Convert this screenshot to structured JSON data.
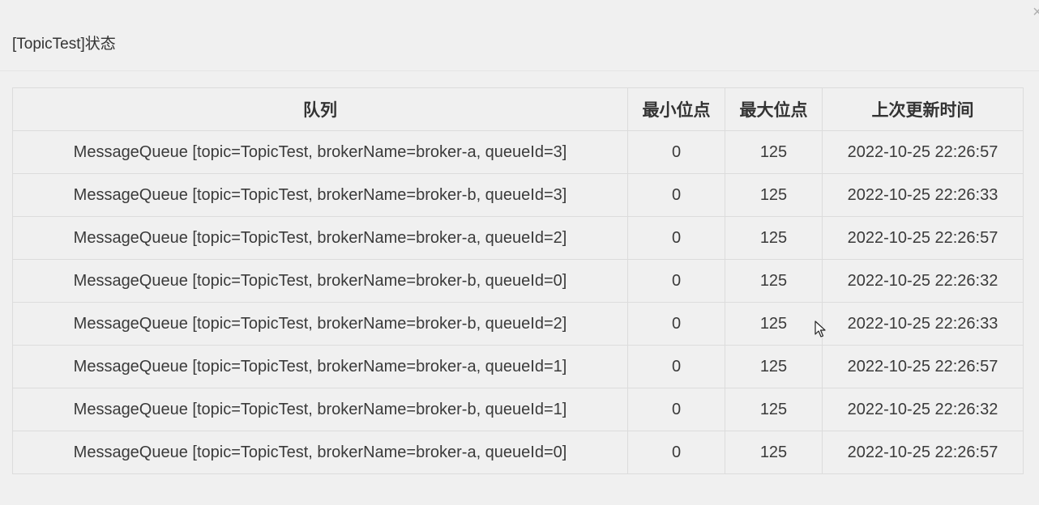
{
  "dialog": {
    "title": "[TopicTest]状态",
    "close_label": "×"
  },
  "table": {
    "headers": [
      "队列",
      "最小位点",
      "最大位点",
      "上次更新时间"
    ],
    "rows": [
      {
        "queue": "MessageQueue [topic=TopicTest, brokerName=broker-a, queueId=3]",
        "min_offset": "0",
        "max_offset": "125",
        "last_update": "2022-10-25 22:26:57"
      },
      {
        "queue": "MessageQueue [topic=TopicTest, brokerName=broker-b, queueId=3]",
        "min_offset": "0",
        "max_offset": "125",
        "last_update": "2022-10-25 22:26:33"
      },
      {
        "queue": "MessageQueue [topic=TopicTest, brokerName=broker-a, queueId=2]",
        "min_offset": "0",
        "max_offset": "125",
        "last_update": "2022-10-25 22:26:57"
      },
      {
        "queue": "MessageQueue [topic=TopicTest, brokerName=broker-b, queueId=0]",
        "min_offset": "0",
        "max_offset": "125",
        "last_update": "2022-10-25 22:26:32"
      },
      {
        "queue": "MessageQueue [topic=TopicTest, brokerName=broker-b, queueId=2]",
        "min_offset": "0",
        "max_offset": "125",
        "last_update": "2022-10-25 22:26:33"
      },
      {
        "queue": "MessageQueue [topic=TopicTest, brokerName=broker-a, queueId=1]",
        "min_offset": "0",
        "max_offset": "125",
        "last_update": "2022-10-25 22:26:57"
      },
      {
        "queue": "MessageQueue [topic=TopicTest, brokerName=broker-b, queueId=1]",
        "min_offset": "0",
        "max_offset": "125",
        "last_update": "2022-10-25 22:26:32"
      },
      {
        "queue": "MessageQueue [topic=TopicTest, brokerName=broker-a, queueId=0]",
        "min_offset": "0",
        "max_offset": "125",
        "last_update": "2022-10-25 22:26:57"
      }
    ]
  }
}
